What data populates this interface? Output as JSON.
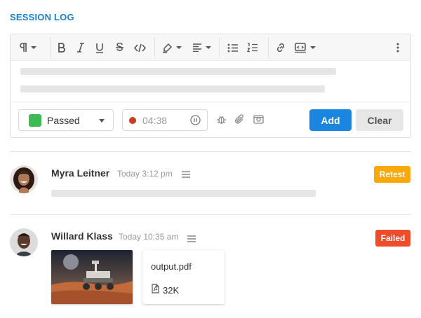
{
  "page": {
    "title": "SESSION LOG"
  },
  "toolbar": {
    "buttons": [
      "paragraph-icon",
      "bold-icon",
      "italic-icon",
      "underline-icon",
      "strikethrough-icon",
      "code-icon",
      "highlighter-icon",
      "align-icon",
      "bullet-list-icon",
      "numbered-list-icon",
      "link-icon",
      "embed-icon",
      "more-icon"
    ]
  },
  "composer": {
    "status": {
      "label": "Passed",
      "color": "#3cba54"
    },
    "timer": {
      "value": "04:38",
      "rec_color": "#cf3a22"
    },
    "attachments": [
      "bug-icon",
      "paperclip-icon",
      "screenshot-icon"
    ],
    "add_label": "Add",
    "clear_label": "Clear"
  },
  "entries": [
    {
      "author": "Myra Leitner",
      "time": "Today 3:12 pm",
      "badge": {
        "label": "Retest",
        "color": "#f9a90a"
      }
    },
    {
      "author": "Willard Klass",
      "time": "Today 10:35 am",
      "badge": {
        "label": "Failed",
        "color": "#ef4c2c"
      },
      "attachment": {
        "file_name": "output.pdf",
        "file_size": "32K"
      }
    }
  ],
  "colors": {
    "accent": "#1a86e0",
    "title": "#1a7fd1"
  }
}
